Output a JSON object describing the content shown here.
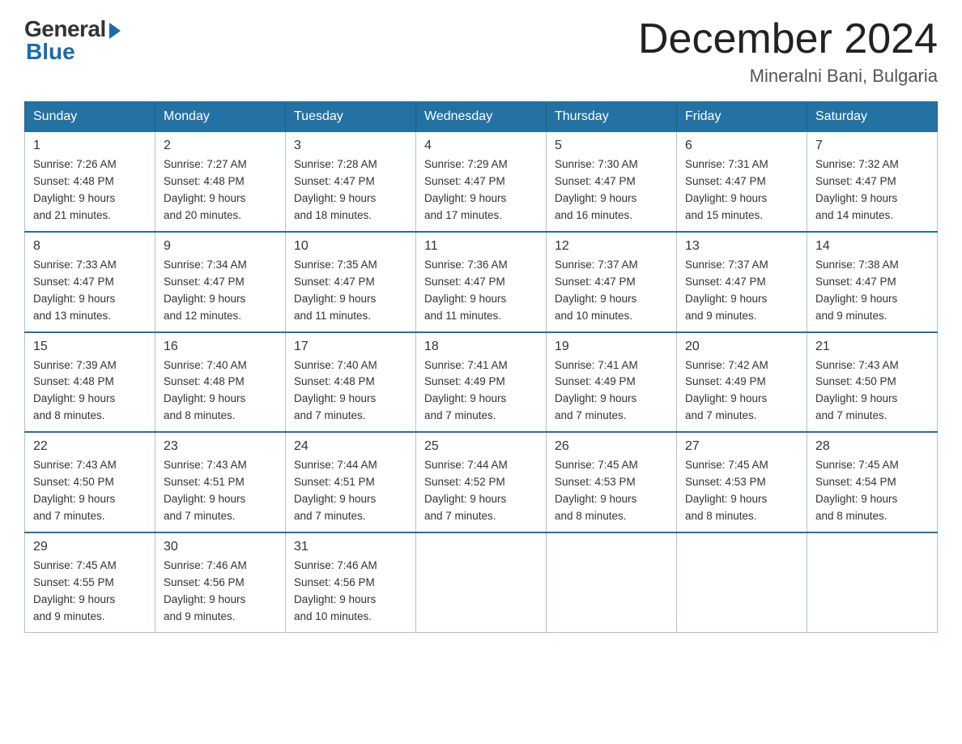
{
  "header": {
    "logo_general": "General",
    "logo_blue": "Blue",
    "month_year": "December 2024",
    "location": "Mineralni Bani, Bulgaria"
  },
  "days_of_week": [
    "Sunday",
    "Monday",
    "Tuesday",
    "Wednesday",
    "Thursday",
    "Friday",
    "Saturday"
  ],
  "weeks": [
    [
      {
        "day": "1",
        "sunrise": "7:26 AM",
        "sunset": "4:48 PM",
        "daylight": "9 hours and 21 minutes."
      },
      {
        "day": "2",
        "sunrise": "7:27 AM",
        "sunset": "4:48 PM",
        "daylight": "9 hours and 20 minutes."
      },
      {
        "day": "3",
        "sunrise": "7:28 AM",
        "sunset": "4:47 PM",
        "daylight": "9 hours and 18 minutes."
      },
      {
        "day": "4",
        "sunrise": "7:29 AM",
        "sunset": "4:47 PM",
        "daylight": "9 hours and 17 minutes."
      },
      {
        "day": "5",
        "sunrise": "7:30 AM",
        "sunset": "4:47 PM",
        "daylight": "9 hours and 16 minutes."
      },
      {
        "day": "6",
        "sunrise": "7:31 AM",
        "sunset": "4:47 PM",
        "daylight": "9 hours and 15 minutes."
      },
      {
        "day": "7",
        "sunrise": "7:32 AM",
        "sunset": "4:47 PM",
        "daylight": "9 hours and 14 minutes."
      }
    ],
    [
      {
        "day": "8",
        "sunrise": "7:33 AM",
        "sunset": "4:47 PM",
        "daylight": "9 hours and 13 minutes."
      },
      {
        "day": "9",
        "sunrise": "7:34 AM",
        "sunset": "4:47 PM",
        "daylight": "9 hours and 12 minutes."
      },
      {
        "day": "10",
        "sunrise": "7:35 AM",
        "sunset": "4:47 PM",
        "daylight": "9 hours and 11 minutes."
      },
      {
        "day": "11",
        "sunrise": "7:36 AM",
        "sunset": "4:47 PM",
        "daylight": "9 hours and 11 minutes."
      },
      {
        "day": "12",
        "sunrise": "7:37 AM",
        "sunset": "4:47 PM",
        "daylight": "9 hours and 10 minutes."
      },
      {
        "day": "13",
        "sunrise": "7:37 AM",
        "sunset": "4:47 PM",
        "daylight": "9 hours and 9 minutes."
      },
      {
        "day": "14",
        "sunrise": "7:38 AM",
        "sunset": "4:47 PM",
        "daylight": "9 hours and 9 minutes."
      }
    ],
    [
      {
        "day": "15",
        "sunrise": "7:39 AM",
        "sunset": "4:48 PM",
        "daylight": "9 hours and 8 minutes."
      },
      {
        "day": "16",
        "sunrise": "7:40 AM",
        "sunset": "4:48 PM",
        "daylight": "9 hours and 8 minutes."
      },
      {
        "day": "17",
        "sunrise": "7:40 AM",
        "sunset": "4:48 PM",
        "daylight": "9 hours and 7 minutes."
      },
      {
        "day": "18",
        "sunrise": "7:41 AM",
        "sunset": "4:49 PM",
        "daylight": "9 hours and 7 minutes."
      },
      {
        "day": "19",
        "sunrise": "7:41 AM",
        "sunset": "4:49 PM",
        "daylight": "9 hours and 7 minutes."
      },
      {
        "day": "20",
        "sunrise": "7:42 AM",
        "sunset": "4:49 PM",
        "daylight": "9 hours and 7 minutes."
      },
      {
        "day": "21",
        "sunrise": "7:43 AM",
        "sunset": "4:50 PM",
        "daylight": "9 hours and 7 minutes."
      }
    ],
    [
      {
        "day": "22",
        "sunrise": "7:43 AM",
        "sunset": "4:50 PM",
        "daylight": "9 hours and 7 minutes."
      },
      {
        "day": "23",
        "sunrise": "7:43 AM",
        "sunset": "4:51 PM",
        "daylight": "9 hours and 7 minutes."
      },
      {
        "day": "24",
        "sunrise": "7:44 AM",
        "sunset": "4:51 PM",
        "daylight": "9 hours and 7 minutes."
      },
      {
        "day": "25",
        "sunrise": "7:44 AM",
        "sunset": "4:52 PM",
        "daylight": "9 hours and 7 minutes."
      },
      {
        "day": "26",
        "sunrise": "7:45 AM",
        "sunset": "4:53 PM",
        "daylight": "9 hours and 8 minutes."
      },
      {
        "day": "27",
        "sunrise": "7:45 AM",
        "sunset": "4:53 PM",
        "daylight": "9 hours and 8 minutes."
      },
      {
        "day": "28",
        "sunrise": "7:45 AM",
        "sunset": "4:54 PM",
        "daylight": "9 hours and 8 minutes."
      }
    ],
    [
      {
        "day": "29",
        "sunrise": "7:45 AM",
        "sunset": "4:55 PM",
        "daylight": "9 hours and 9 minutes."
      },
      {
        "day": "30",
        "sunrise": "7:46 AM",
        "sunset": "4:56 PM",
        "daylight": "9 hours and 9 minutes."
      },
      {
        "day": "31",
        "sunrise": "7:46 AM",
        "sunset": "4:56 PM",
        "daylight": "9 hours and 10 minutes."
      },
      null,
      null,
      null,
      null
    ]
  ]
}
